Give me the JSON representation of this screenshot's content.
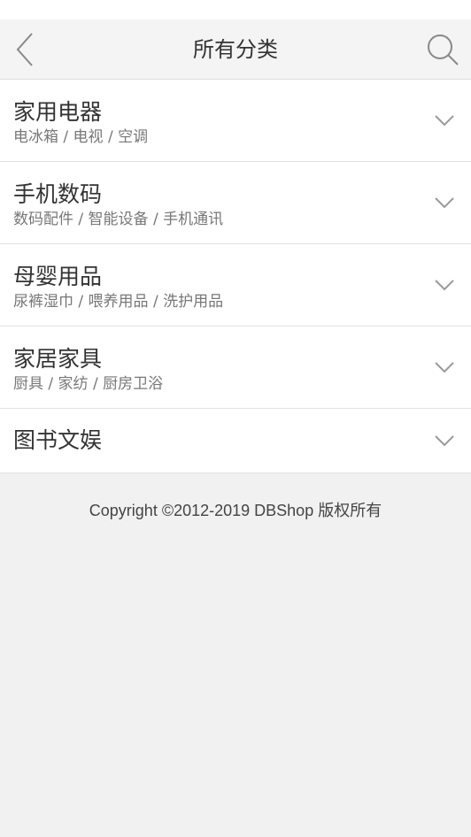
{
  "header": {
    "title": "所有分类",
    "back_icon": "chevron-left-icon",
    "search_icon": "search-icon"
  },
  "categories": [
    {
      "name": "家用电器",
      "sub": "电冰箱 / 电视 / 空调"
    },
    {
      "name": "手机数码",
      "sub": "数码配件 / 智能设备 / 手机通讯"
    },
    {
      "name": "母婴用品",
      "sub": "尿裤湿巾 / 喂养用品 / 洗护用品"
    },
    {
      "name": "家居家具",
      "sub": "厨具 / 家纺 / 厨房卫浴"
    },
    {
      "name": "图书文娱",
      "sub": ""
    }
  ],
  "footer": {
    "copyright": "Copyright ©2012-2019 DBShop 版权所有"
  },
  "colors": {
    "header_bg": "#f4f4f4",
    "page_bg": "#f1f1f1",
    "text_primary": "#333333",
    "text_secondary": "#777777"
  }
}
